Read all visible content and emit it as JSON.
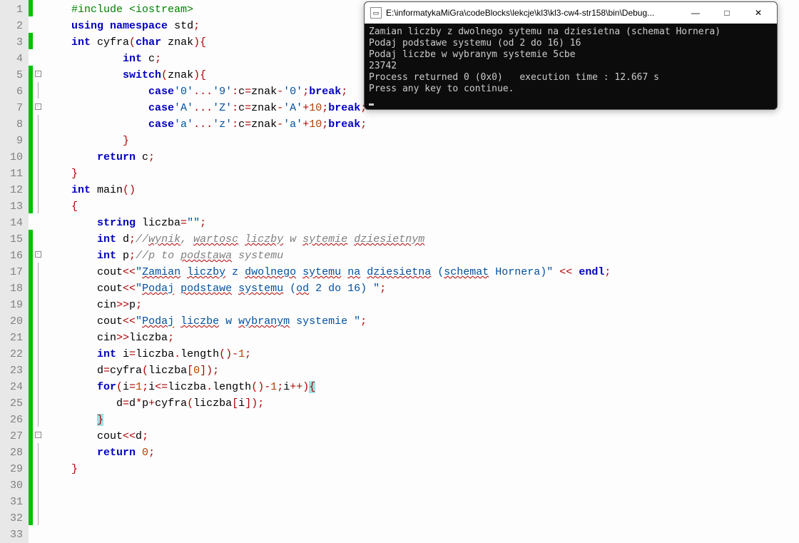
{
  "lines": [
    {
      "n": 1,
      "mark": "green",
      "fold": "",
      "tokens": [
        [
          "    ",
          ""
        ],
        [
          "#include <iostream>",
          "pp"
        ]
      ]
    },
    {
      "n": 2,
      "mark": "",
      "fold": "",
      "tokens": [
        [
          "",
          ""
        ]
      ]
    },
    {
      "n": 3,
      "mark": "green",
      "fold": "",
      "tokens": [
        [
          "    ",
          ""
        ],
        [
          "using namespace",
          "kw"
        ],
        [
          " ",
          ""
        ],
        [
          "std",
          "fn"
        ],
        [
          ";",
          "op"
        ]
      ]
    },
    {
      "n": 4,
      "mark": "",
      "fold": "",
      "tokens": [
        [
          "",
          ""
        ]
      ]
    },
    {
      "n": 5,
      "mark": "green",
      "fold": "box",
      "tokens": [
        [
          "    ",
          ""
        ],
        [
          "int",
          "kw"
        ],
        [
          " cyfra",
          ""
        ],
        [
          "(",
          "op"
        ],
        [
          "char",
          "kw"
        ],
        [
          " znak",
          ""
        ],
        [
          ")",
          "op"
        ],
        [
          "{",
          "op"
        ]
      ]
    },
    {
      "n": 6,
      "mark": "green",
      "fold": "line",
      "tokens": [
        [
          "            ",
          ""
        ],
        [
          "int",
          "kw"
        ],
        [
          " c",
          ""
        ],
        [
          ";",
          "op"
        ]
      ]
    },
    {
      "n": 7,
      "mark": "green",
      "fold": "box",
      "tokens": [
        [
          "            ",
          ""
        ],
        [
          "switch",
          "kw"
        ],
        [
          "(",
          "op"
        ],
        [
          "znak",
          ""
        ],
        [
          ")",
          "op"
        ],
        [
          "{",
          "op"
        ]
      ]
    },
    {
      "n": 8,
      "mark": "green",
      "fold": "line",
      "tokens": [
        [
          "                ",
          ""
        ],
        [
          "case",
          "kw"
        ],
        [
          "'0'",
          "str"
        ],
        [
          "...",
          "op"
        ],
        [
          "'9'",
          "str"
        ],
        [
          ":",
          "op"
        ],
        [
          "c",
          ""
        ],
        [
          "=",
          "op"
        ],
        [
          "znak",
          ""
        ],
        [
          "-",
          "op"
        ],
        [
          "'0'",
          "str"
        ],
        [
          ";",
          "op"
        ],
        [
          "break",
          "kw"
        ],
        [
          ";",
          "op"
        ]
      ]
    },
    {
      "n": 9,
      "mark": "green",
      "fold": "line",
      "tokens": [
        [
          "                ",
          ""
        ],
        [
          "case",
          "kw"
        ],
        [
          "'A'",
          "str"
        ],
        [
          "...",
          "op"
        ],
        [
          "'Z'",
          "str"
        ],
        [
          ":",
          "op"
        ],
        [
          "c",
          ""
        ],
        [
          "=",
          "op"
        ],
        [
          "znak",
          ""
        ],
        [
          "-",
          "op"
        ],
        [
          "'A'",
          "str"
        ],
        [
          "+",
          "op"
        ],
        [
          "10",
          "num"
        ],
        [
          ";",
          "op"
        ],
        [
          "break",
          "kw"
        ],
        [
          ";",
          "op"
        ]
      ]
    },
    {
      "n": 10,
      "mark": "green",
      "fold": "line",
      "tokens": [
        [
          "                ",
          ""
        ],
        [
          "case",
          "kw"
        ],
        [
          "'a'",
          "str"
        ],
        [
          "...",
          "op"
        ],
        [
          "'z'",
          "str"
        ],
        [
          ":",
          "op"
        ],
        [
          "c",
          ""
        ],
        [
          "=",
          "op"
        ],
        [
          "znak",
          ""
        ],
        [
          "-",
          "op"
        ],
        [
          "'a'",
          "str"
        ],
        [
          "+",
          "op"
        ],
        [
          "10",
          "num"
        ],
        [
          ";",
          "op"
        ],
        [
          "break",
          "kw"
        ],
        [
          ";",
          "op"
        ]
      ]
    },
    {
      "n": 11,
      "mark": "green",
      "fold": "line",
      "tokens": [
        [
          "            ",
          ""
        ],
        [
          "}",
          "op"
        ]
      ]
    },
    {
      "n": 12,
      "mark": "green",
      "fold": "line",
      "tokens": [
        [
          "        ",
          ""
        ],
        [
          "return",
          "kw"
        ],
        [
          " c",
          ""
        ],
        [
          ";",
          "op"
        ]
      ]
    },
    {
      "n": 13,
      "mark": "green",
      "fold": "line",
      "tokens": [
        [
          "    ",
          ""
        ],
        [
          "}",
          "op"
        ]
      ]
    },
    {
      "n": 14,
      "mark": "",
      "fold": "",
      "tokens": [
        [
          "",
          ""
        ]
      ]
    },
    {
      "n": 15,
      "mark": "green",
      "fold": "",
      "tokens": [
        [
          "    ",
          ""
        ],
        [
          "int",
          "kw"
        ],
        [
          " main",
          ""
        ],
        [
          "()",
          "op"
        ]
      ]
    },
    {
      "n": 16,
      "mark": "green",
      "fold": "box",
      "tokens": [
        [
          "    ",
          ""
        ],
        [
          "{",
          "op"
        ]
      ]
    },
    {
      "n": 17,
      "mark": "green",
      "fold": "line",
      "tokens": [
        [
          "        ",
          ""
        ],
        [
          "string",
          "kw"
        ],
        [
          " liczba",
          ""
        ],
        [
          "=",
          "op"
        ],
        [
          "\"\"",
          "str"
        ],
        [
          ";",
          "op"
        ]
      ]
    },
    {
      "n": 18,
      "mark": "green",
      "fold": "line",
      "tokens": [
        [
          "        ",
          ""
        ],
        [
          "int",
          "kw"
        ],
        [
          " d",
          ""
        ],
        [
          ";",
          "op"
        ],
        [
          "//",
          "cmt"
        ],
        [
          "wynik",
          "cmt spell"
        ],
        [
          ", ",
          "cmt"
        ],
        [
          "wartosc",
          "cmt spell"
        ],
        [
          " ",
          "cmt"
        ],
        [
          "liczby",
          "cmt spell"
        ],
        [
          " w ",
          "cmt"
        ],
        [
          "sytemie",
          "cmt spell"
        ],
        [
          " ",
          "cmt"
        ],
        [
          "dziesietnym",
          "cmt spell"
        ]
      ]
    },
    {
      "n": 19,
      "mark": "green",
      "fold": "line",
      "tokens": [
        [
          "        ",
          ""
        ],
        [
          "int",
          "kw"
        ],
        [
          " p",
          ""
        ],
        [
          ";",
          "op"
        ],
        [
          "//p to ",
          "cmt"
        ],
        [
          "podstawa",
          "cmt spell"
        ],
        [
          " systemu",
          "cmt"
        ]
      ]
    },
    {
      "n": 20,
      "mark": "green",
      "fold": "line",
      "tokens": [
        [
          "        ",
          ""
        ],
        [
          "cout",
          "fn"
        ],
        [
          "<<",
          "op"
        ],
        [
          "\"",
          "str"
        ],
        [
          "Zamian",
          "str spell"
        ],
        [
          " ",
          "str"
        ],
        [
          "liczby",
          "str spell"
        ],
        [
          " z ",
          "str"
        ],
        [
          "dwolnego",
          "str spell"
        ],
        [
          " ",
          "str"
        ],
        [
          "sytemu",
          "str spell"
        ],
        [
          " ",
          "str"
        ],
        [
          "na",
          "str spell"
        ],
        [
          " ",
          "str"
        ],
        [
          "dziesietna",
          "str spell"
        ],
        [
          " (",
          "str"
        ],
        [
          "schemat",
          "str spell"
        ],
        [
          " Hornera)\"",
          "str"
        ],
        [
          " ",
          ""
        ],
        [
          "<<",
          "op"
        ],
        [
          " ",
          ""
        ],
        [
          "endl",
          "kw"
        ],
        [
          ";",
          "op"
        ]
      ]
    },
    {
      "n": 21,
      "mark": "green",
      "fold": "line",
      "tokens": [
        [
          "        ",
          ""
        ],
        [
          "cout",
          "fn"
        ],
        [
          "<<",
          "op"
        ],
        [
          "\"",
          "str"
        ],
        [
          "Podaj",
          "str spell"
        ],
        [
          " ",
          "str"
        ],
        [
          "podstawe",
          "str spell"
        ],
        [
          " ",
          "str"
        ],
        [
          "systemu",
          "str spell"
        ],
        [
          " (",
          "str"
        ],
        [
          "od",
          "str spell"
        ],
        [
          " 2 do 16) \"",
          "str"
        ],
        [
          ";",
          "op"
        ]
      ]
    },
    {
      "n": 22,
      "mark": "green",
      "fold": "line",
      "tokens": [
        [
          "        ",
          ""
        ],
        [
          "cin",
          "fn"
        ],
        [
          ">>",
          "op"
        ],
        [
          "p",
          ""
        ],
        [
          ";",
          "op"
        ]
      ]
    },
    {
      "n": 23,
      "mark": "green",
      "fold": "line",
      "tokens": [
        [
          "        ",
          ""
        ],
        [
          "cout",
          "fn"
        ],
        [
          "<<",
          "op"
        ],
        [
          "\"",
          "str"
        ],
        [
          "Podaj",
          "str spell"
        ],
        [
          " ",
          "str"
        ],
        [
          "liczbe",
          "str spell"
        ],
        [
          " w ",
          "str"
        ],
        [
          "wybranym",
          "str spell"
        ],
        [
          " systemie \"",
          "str"
        ],
        [
          ";",
          "op"
        ]
      ]
    },
    {
      "n": 24,
      "mark": "green",
      "fold": "line",
      "tokens": [
        [
          "        ",
          ""
        ],
        [
          "cin",
          "fn"
        ],
        [
          ">>",
          "op"
        ],
        [
          "liczba",
          ""
        ],
        [
          ";",
          "op"
        ]
      ]
    },
    {
      "n": 25,
      "mark": "green",
      "fold": "line",
      "tokens": [
        [
          "        ",
          ""
        ],
        [
          "int",
          "kw"
        ],
        [
          " i",
          ""
        ],
        [
          "=",
          "op"
        ],
        [
          "liczba",
          ""
        ],
        [
          ".",
          "op"
        ],
        [
          "length",
          ""
        ],
        [
          "()-",
          "op"
        ],
        [
          "1",
          "num"
        ],
        [
          ";",
          "op"
        ]
      ]
    },
    {
      "n": 26,
      "mark": "green",
      "fold": "line",
      "tokens": [
        [
          "        d",
          ""
        ],
        [
          "=",
          "op"
        ],
        [
          "cyfra",
          ""
        ],
        [
          "(",
          "op"
        ],
        [
          "liczba",
          ""
        ],
        [
          "[",
          "op"
        ],
        [
          "0",
          "num"
        ],
        [
          "]);",
          "op"
        ]
      ]
    },
    {
      "n": 27,
      "mark": "green",
      "fold": "box",
      "tokens": [
        [
          "        ",
          ""
        ],
        [
          "for",
          "kw"
        ],
        [
          "(",
          "op"
        ],
        [
          "i",
          ""
        ],
        [
          "=",
          "op"
        ],
        [
          "1",
          "num"
        ],
        [
          ";",
          "op"
        ],
        [
          "i",
          ""
        ],
        [
          "<=",
          "op"
        ],
        [
          "liczba",
          ""
        ],
        [
          ".",
          "op"
        ],
        [
          "length",
          ""
        ],
        [
          "()-",
          "op"
        ],
        [
          "1",
          "num"
        ],
        [
          ";",
          "op"
        ],
        [
          "i",
          ""
        ],
        [
          "++)",
          "op"
        ],
        [
          "{",
          "op hl"
        ]
      ]
    },
    {
      "n": 28,
      "mark": "green",
      "fold": "line",
      "tokens": [
        [
          "           d",
          ""
        ],
        [
          "=",
          "op"
        ],
        [
          "d",
          ""
        ],
        [
          "*",
          "op"
        ],
        [
          "p",
          ""
        ],
        [
          "+",
          "op"
        ],
        [
          "cyfra",
          ""
        ],
        [
          "(",
          "op"
        ],
        [
          "liczba",
          ""
        ],
        [
          "[",
          "op"
        ],
        [
          "i",
          ""
        ],
        [
          "]);",
          "op"
        ]
      ]
    },
    {
      "n": 29,
      "mark": "green",
      "fold": "line",
      "tokens": [
        [
          "        ",
          ""
        ],
        [
          "}",
          "op hl"
        ]
      ]
    },
    {
      "n": 30,
      "mark": "green",
      "fold": "line",
      "tokens": [
        [
          "        ",
          ""
        ],
        [
          "cout",
          "fn"
        ],
        [
          "<<",
          "op"
        ],
        [
          "d",
          ""
        ],
        [
          ";",
          "op"
        ]
      ]
    },
    {
      "n": 31,
      "mark": "green",
      "fold": "line",
      "tokens": [
        [
          "        ",
          ""
        ],
        [
          "return",
          "kw"
        ],
        [
          " ",
          ""
        ],
        [
          "0",
          "num"
        ],
        [
          ";",
          "op"
        ]
      ]
    },
    {
      "n": 32,
      "mark": "green",
      "fold": "line",
      "tokens": [
        [
          "    ",
          ""
        ],
        [
          "}",
          "op"
        ]
      ]
    },
    {
      "n": 33,
      "mark": "",
      "fold": "",
      "tokens": [
        [
          "",
          ""
        ]
      ]
    }
  ],
  "console": {
    "title": "E:\\informatykaMiGra\\codeBlocks\\lekcje\\kl3\\kl3-cw4-str158\\bin\\Debug...",
    "lines": [
      "Zamian liczby z dwolnego sytemu na dziesietna (schemat Hornera)",
      "Podaj podstawe systemu (od 2 do 16) 16",
      "Podaj liczbe w wybranym systemie 5cbe",
      "23742",
      "Process returned 0 (0x0)   execution time : 12.667 s",
      "Press any key to continue."
    ],
    "buttons": {
      "min": "—",
      "max": "□",
      "close": "✕"
    }
  }
}
